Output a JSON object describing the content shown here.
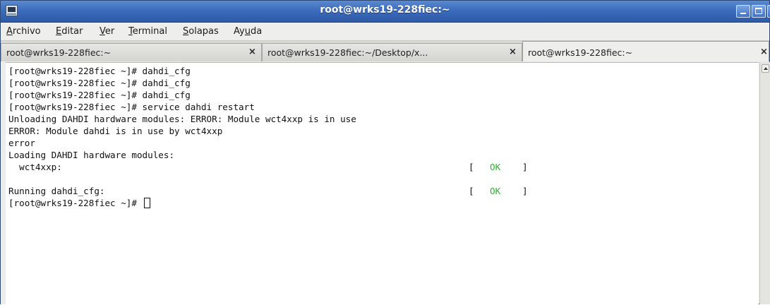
{
  "window": {
    "title": "root@wrks19-228fiec:~"
  },
  "menu": [
    {
      "label": "Archivo",
      "mnemonic_index": 0
    },
    {
      "label": "Editar",
      "mnemonic_index": 0
    },
    {
      "label": "Ver",
      "mnemonic_index": 0
    },
    {
      "label": "Terminal",
      "mnemonic_index": 0
    },
    {
      "label": "Solapas",
      "mnemonic_index": 0
    },
    {
      "label": "Ayuda",
      "mnemonic_index": 2
    }
  ],
  "tabs": [
    {
      "label": "root@wrks19-228fiec:~",
      "close": "×",
      "active": false
    },
    {
      "label": "root@wrks19-228fiec:~/Desktop/x...",
      "close": "×",
      "active": false
    },
    {
      "label": "root@wrks19-228fiec:~",
      "close": "×",
      "active": true
    }
  ],
  "terminal": {
    "lines": [
      "[root@wrks19-228fiec ~]# dahdi_cfg",
      "[root@wrks19-228fiec ~]# dahdi_cfg",
      "[root@wrks19-228fiec ~]# dahdi_cfg",
      "[root@wrks19-228fiec ~]# service dahdi restart",
      "Unloading DAHDI hardware modules: ERROR: Module wct4xxp is in use",
      "ERROR: Module dahdi is in use by wct4xxp",
      "error",
      "Loading DAHDI hardware modules:",
      "  wct4xxp:",
      "",
      "Running dahdi_cfg:",
      "[root@wrks19-228fiec ~]# "
    ],
    "status": {
      "open": "[",
      "text": "OK",
      "close": "]"
    },
    "ok_color": "#2db52d"
  }
}
